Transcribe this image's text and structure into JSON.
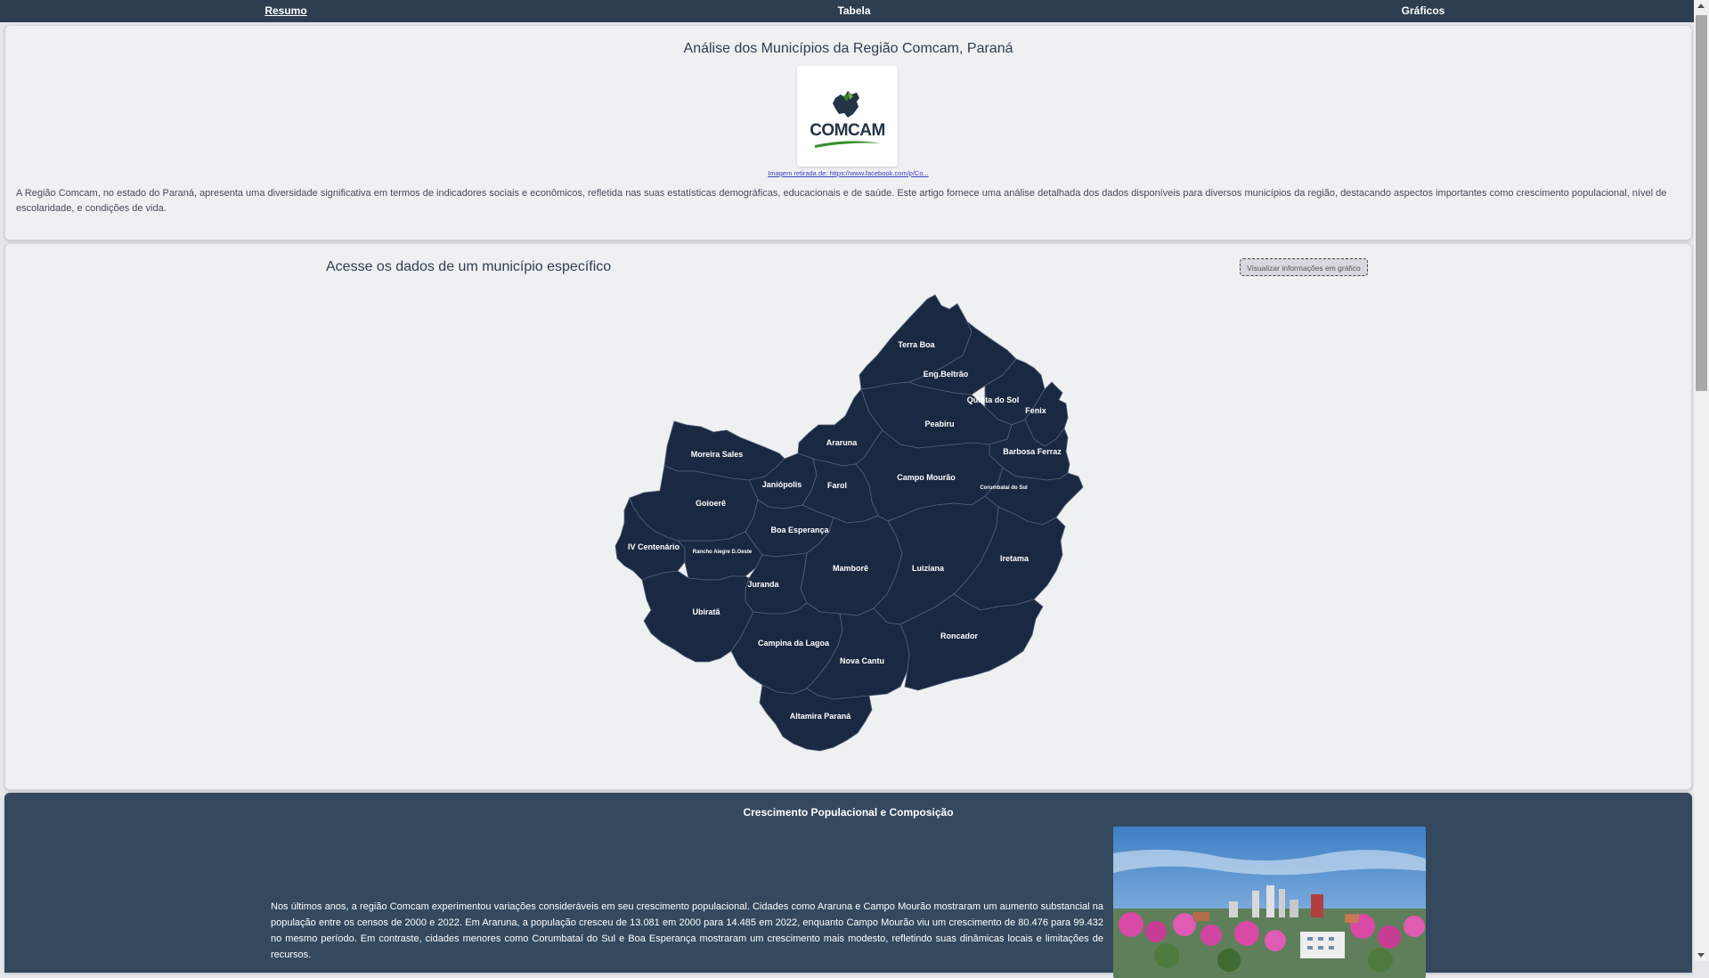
{
  "nav": {
    "items": [
      {
        "label": "Resumo",
        "active": true
      },
      {
        "label": "Tabela",
        "active": false
      },
      {
        "label": "Gráficos",
        "active": false
      }
    ]
  },
  "intro": {
    "title": "Análise dos Municípios da Região Comcam, Paraná",
    "logo_text": "COMCAM",
    "image_credit": "Imagem retirada de: https://www.facebook.com/p/Co...",
    "paragraph": "A Região Comcam, no estado do Paraná, apresenta uma diversidade significativa em termos de indicadores sociais e econômicos, refletida nas suas estatísticas demográficas, educacionais e de saúde. Este artigo fornece uma análise detalhada dos dados disponíveis para diversos municípios da região, destacando aspectos importantes como crescimento populacional, nível de escolaridade, e condições de vida."
  },
  "map_section": {
    "title": "Acesse os dados de um município específico",
    "chart_button": "Visualizar informações em gráfico",
    "municipalities": [
      "Terra Boa",
      "Eng.Beltrão",
      "Quinta do Sol",
      "Fenix",
      "Peabiru",
      "Barbosa Ferraz",
      "Araruna",
      "Campo Mourão",
      "Corumbataí do Sul",
      "Moreira Sales",
      "Janiópolis",
      "Farol",
      "Goioerê",
      "Boa Esperança",
      "IV Centenário",
      "Rancho Alegre D.Oeste",
      "Mamborê",
      "Luiziana",
      "Iretama",
      "Juranda",
      "Ubiratã",
      "Campina da Lagoa",
      "Nova Cantu",
      "Roncador",
      "Altamira Paraná"
    ]
  },
  "growth": {
    "title": "Crescimento Populacional e Composição",
    "paragraph": "Nos últimos anos, a região Comcam experimentou variações consideráveis em seu crescimento populacional. Cidades como Araruna e Campo Mourão mostraram um aumento substancial na população entre os censos de 2000 e 2022. Em Araruna, a população cresceu de 13.081 em 2000 para 14.485 em 2022, enquanto Campo Mourão viu um crescimento de 80.476 para 99.432 no mesmo período. Em contraste, cidades menores como Corumbataí do Sul e Boa Esperança mostraram um crescimento mais modesto, refletindo suas dinâmicas locais e limitações de recursos."
  },
  "colors": {
    "navbar": "#2d3e50",
    "map_fill": "#1a2942",
    "dark_section": "#34495e"
  }
}
